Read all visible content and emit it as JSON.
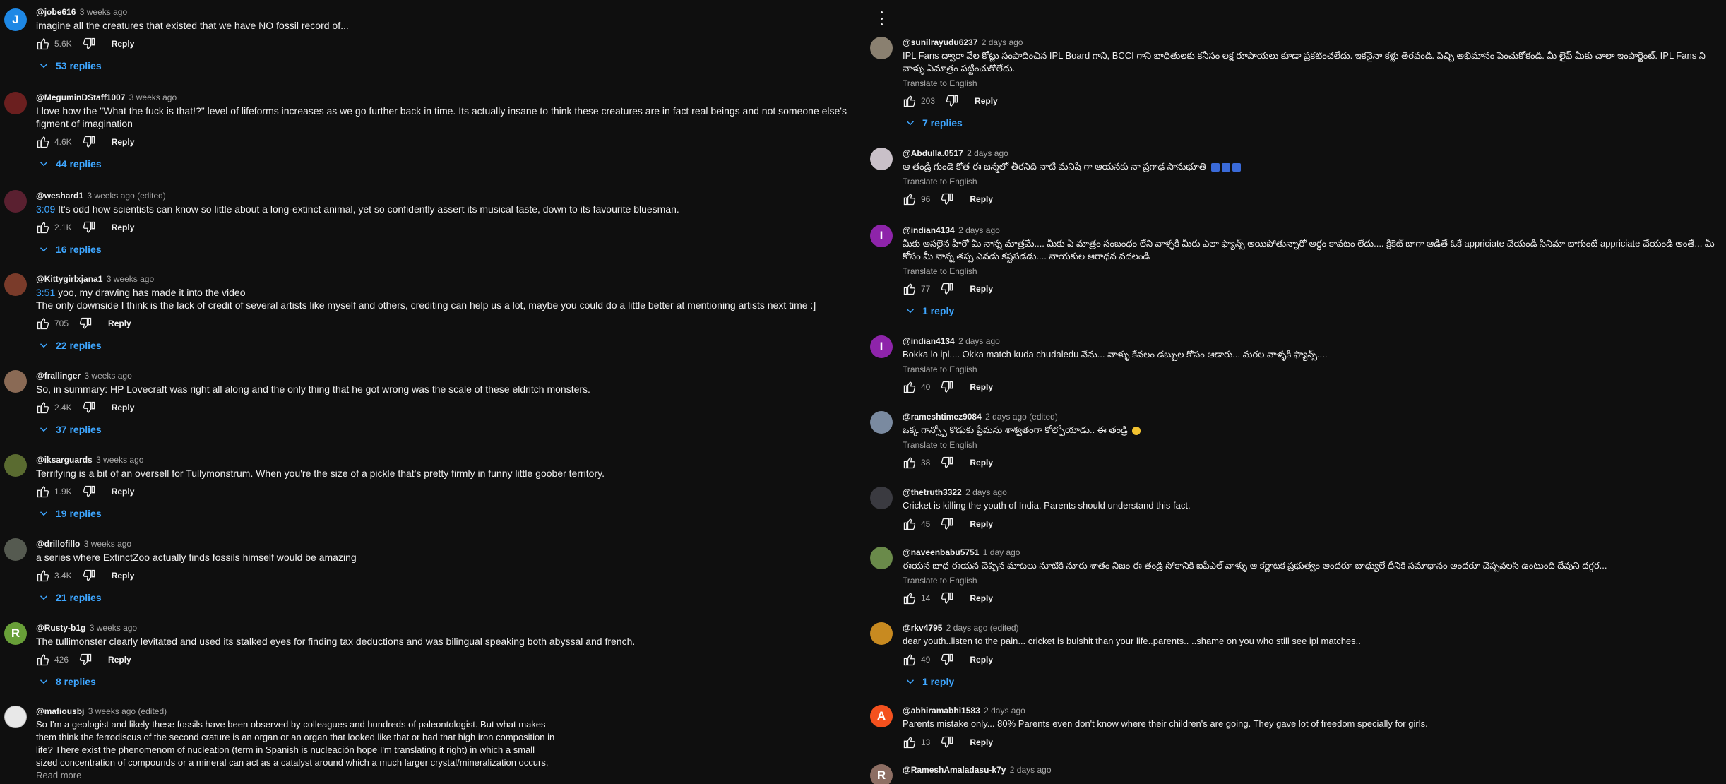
{
  "ui": {
    "reply_label": "Reply",
    "translate_label": "Translate to English",
    "read_more": "Read more"
  },
  "colors": {
    "background": "#0f0f0f",
    "link": "#3ea6ff",
    "muted": "#aaaaaa"
  },
  "left": [
    {
      "author": "@jobe616",
      "time": "3 weeks ago",
      "text": "imagine all the creatures that existed that we have NO fossil record of...",
      "likes": "5.6K",
      "replies": "53 replies",
      "avatar_letter": "J",
      "avatar_color": "#1e88e5"
    },
    {
      "author": "@MeguminDStaff1007",
      "time": "3 weeks ago",
      "text": "I love how the \"What the fuck is that!?\" level of lifeforms increases as we go further back in time. Its actually insane to think these creatures are in fact real beings and not someone else's figment of imagination",
      "likes": "4.6K",
      "replies": "44 replies",
      "avatar_letter": "",
      "avatar_color": "#6b1f1f"
    },
    {
      "author": "@weshard1",
      "time": "3 weeks ago (edited)",
      "timestamp": "3:09",
      "text": "It's odd how scientists can know so little about a long-extinct animal, yet so confidently assert its musical taste, down to its favourite bluesman.",
      "likes": "2.1K",
      "replies": "16 replies",
      "avatar_letter": "",
      "avatar_color": "#5a2030"
    },
    {
      "author": "@Kittygirlxjana1",
      "time": "3 weeks ago",
      "timestamp": "3:51",
      "text": "yoo, my drawing has made it into the video",
      "text2": "The only downside I think is the lack of credit of several artists like myself and others, crediting can help us a lot, maybe you could do a little better at mentioning artists next time :]",
      "likes": "705",
      "replies": "22 replies",
      "avatar_letter": "",
      "avatar_color": "#7a3b2a"
    },
    {
      "author": "@frallinger",
      "time": "3 weeks ago",
      "text": "So, in summary: HP Lovecraft was right all along and the only thing that he got wrong was the scale of these eldritch monsters.",
      "likes": "2.4K",
      "replies": "37 replies",
      "avatar_letter": "",
      "avatar_color": "#8a6a55"
    },
    {
      "author": "@iksarguards",
      "time": "3 weeks ago",
      "text": "Terrifying is a bit of an oversell for Tullymonstrum. When you're the size of a pickle that's pretty firmly in funny little goober territory.",
      "likes": "1.9K",
      "replies": "19 replies",
      "avatar_letter": "",
      "avatar_color": "#5a6b30"
    },
    {
      "author": "@drillofillo",
      "time": "3 weeks ago",
      "text": "a series where ExtinctZoo actually finds fossils himself would be amazing",
      "likes": "3.4K",
      "replies": "21 replies",
      "avatar_letter": "",
      "avatar_color": "#555a50"
    },
    {
      "author": "@Rusty-b1g",
      "time": "3 weeks ago",
      "text": "The tullimonster clearly levitated and used its stalked eyes for finding tax deductions and was bilingual speaking both abyssal and french.",
      "likes": "426",
      "replies": "8 replies",
      "avatar_letter": "R",
      "avatar_color": "#689f38"
    },
    {
      "author": "@mafiousbj",
      "time": "3 weeks ago (edited)",
      "text": "So I'm a geologist and likely these fossils have been observed by colleagues and hundreds of paleontologist. But what makes them think the ferrodiscus of the second crature is an organ or an organ that looked like that or had that high iron composition in life? There exist the phenomenom of nucleation (term in Spanish is nucleación hope I'm translating it right) in which a small sized concentration of compounds or a mineral can act as a catalyst around which a much larger crystal/mineralization occurs, like orders of magnitude larger and far more concentrated. It could happen that the composition of that organ is a prime candidate to attract ferrous ions forming iron based minerals around it. It would be interesting to see how that organ looks preserved in different types of rocks, but the issue is these soft ...",
      "avatar_letter": "",
      "avatar_color": "#e8e8e8"
    }
  ],
  "right": [
    {
      "author": "@sunilrayudu6237",
      "time": "2 days ago",
      "text": "IPL Fans ద్వారా వేల కోట్లు సంపాదించిన IPL Board గాని, BCCI గాని బాధితులకు కనీసం లక్ష రూపాయలు కూడా ప్రకటించలేదు. ఇకనైనా కళ్లు తెరవండి. పిచ్చి అభిమానం పెంచుకోకండి. మీ లైఫ్ మీకు చాలా ఇంపార్టెంట్. IPL Fans ని వాళ్ళు ఏమాత్రం పట్టించుకోలేదు.",
      "translate": true,
      "likes": "203",
      "replies": "7 replies",
      "avatar_color": "#8a8070"
    },
    {
      "author": "@Abdulla.0517",
      "time": "2 days ago",
      "text": "ఆ తండ్రి గుండె కోత ఈ జన్మలో తీరనిది నాటి మనిషి గా ఆయనకు నా ప్రగాఢ సానుభూతి",
      "emoji": "blue",
      "translate": true,
      "likes": "96",
      "avatar_color": "#c9c0c8"
    },
    {
      "author": "@indian4134",
      "time": "2 days ago",
      "text": "మీకు అసలైన హీరో మీ నాన్న మాత్రమే.... మీకు ఏ మాత్రం సంబంధం లేని వాళ్ళకి మీరు ఎలా ఫ్యాన్స్ అయిపోతున్నారో అర్ధం కావటం లేదు.... క్రికెట్ బాగా ఆడితే ఓకే appriciate చేయండి సినిమా బాగుంటే appriciate చేయండి అంతే... మీ కోసం మీ నాన్న తప్ప ఎవడు కష్టపడడు.... నాయకుల ఆరాధన వదలండి",
      "translate": true,
      "likes": "77",
      "replies": "1 reply",
      "avatar_letter": "I",
      "avatar_color": "#8e24aa"
    },
    {
      "author": "@indian4134",
      "time": "2 days ago",
      "text": "Bokka lo ipl.... Okka match kuda chudaledu నేను... వాళ్ళు కేవలం డబ్బుల కోసం ఆడారు... మరల వాళ్ళకి ఫ్యాన్స్....",
      "translate": true,
      "likes": "40",
      "avatar_letter": "I",
      "avatar_color": "#8e24aa"
    },
    {
      "author": "@rameshtimez9084",
      "time": "2 days ago (edited)",
      "text": "ఒక్క గాన్స్బో కొడుకు ప్రేమను శాశ్వతంగా కోల్పోయాడు.. ఈ తండ్రి",
      "emoji": "yellow",
      "translate": true,
      "likes": "38",
      "avatar_color": "#7a8aa0"
    },
    {
      "author": "@thetruth3322",
      "time": "2 days ago",
      "text": "Cricket is killing the youth of India. Parents should understand this fact.",
      "likes": "45",
      "avatar_color": "#3a3a40"
    },
    {
      "author": "@naveenbabu5751",
      "time": "1 day ago",
      "text": "ఈయన బాధ ఈయన చెప్పిన మాటలు నూటికి నూరు శాతం నిజం ఈ తండ్రి సోకానికి ఐపీఎల్ వాళ్ళు ఆ కర్ణాటక ప్రభుత్వం అందరూ బాధ్యులే దీనికి సమాధానం అందరూ చెప్పవలసి ఉంటుంది దేవుని దగ్గర...",
      "translate": true,
      "likes": "14",
      "avatar_color": "#6a8a4a"
    },
    {
      "author": "@rkv4795",
      "time": "2 days ago (edited)",
      "text": "dear youth..listen to the pain... cricket is bulshit than your life..parents.. ..shame on you who still see ipl matches..",
      "likes": "49",
      "replies": "1 reply",
      "avatar_color": "#c88a20"
    },
    {
      "author": "@abhiramabhi1583",
      "time": "2 days ago",
      "text": "Parents mistake only... 80% Parents even don't know where their children's are going. They gave lot of freedom specially for girls.",
      "likes": "13",
      "avatar_letter": "A",
      "avatar_color": "#f4511e"
    },
    {
      "author": "@RameshAmaladasu-k7y",
      "time": "2 days ago",
      "avatar_letter": "R",
      "avatar_color": "#8d6e63"
    }
  ]
}
